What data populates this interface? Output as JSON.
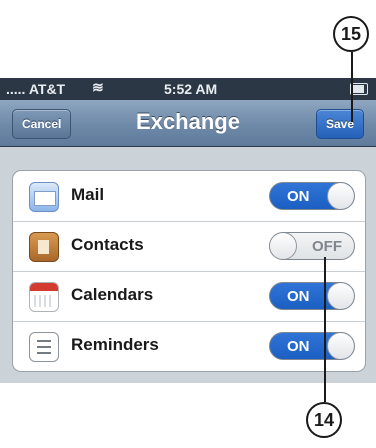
{
  "status_bar": {
    "carrier": "..... AT&T",
    "time": "5:52 AM"
  },
  "nav": {
    "title": "Exchange",
    "cancel_label": "Cancel",
    "save_label": "Save"
  },
  "rows": [
    {
      "label": "Mail",
      "icon": "mail-icon",
      "toggle": "ON",
      "on": true
    },
    {
      "label": "Contacts",
      "icon": "contacts-icon",
      "toggle": "OFF",
      "on": false
    },
    {
      "label": "Calendars",
      "icon": "calendars-icon",
      "toggle": "ON",
      "on": true
    },
    {
      "label": "Reminders",
      "icon": "reminders-icon",
      "toggle": "ON",
      "on": true
    }
  ],
  "callouts": {
    "save": "15",
    "contacts": "14"
  },
  "colors": {
    "toggle_on": "#1c5fc3",
    "nav_bar": "#6e89a8",
    "save_button": "#2461b8"
  }
}
